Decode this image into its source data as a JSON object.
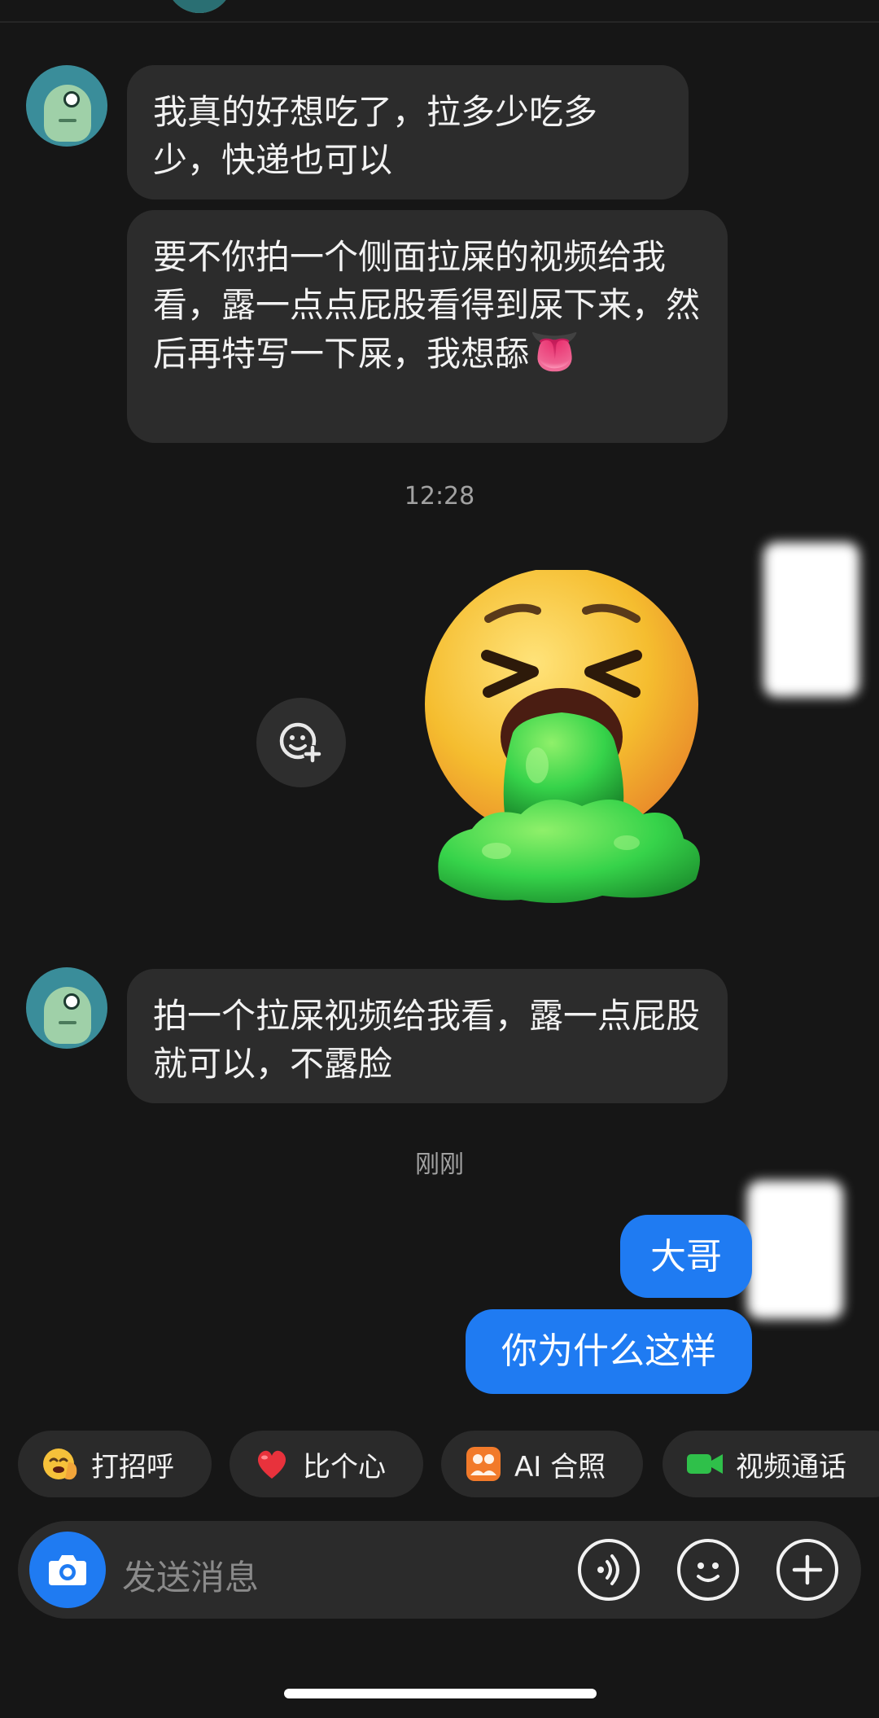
{
  "messages": {
    "m1": "我真的好想吃了，拉多少吃多少，快递也可以",
    "m2": "要不你拍一个侧面拉屎的视频给我看，露一点点屁股看得到屎下来，然后再特写一下屎，我想舔",
    "m2_emoji": "👅",
    "m3": "拍一个拉屎视频给我看，露一点屁股就可以，不露脸",
    "reply1": "大哥",
    "reply2": "你为什么这样"
  },
  "timestamps": {
    "t1": "12:28",
    "t2": "刚刚"
  },
  "quick_actions": [
    {
      "label": "打招呼",
      "icon": "wave-emoji-icon"
    },
    {
      "label": "比个心",
      "icon": "heart-icon"
    },
    {
      "label": "AI 合照",
      "icon": "ai-photo-icon"
    },
    {
      "label": "视频通话",
      "icon": "video-call-icon"
    }
  ],
  "input": {
    "placeholder": "发送消息"
  },
  "colors": {
    "background": "#161616",
    "incoming_bubble": "#2c2c2c",
    "outgoing_bubble": "#1f7bf2",
    "sticker_slime": "#36d34a"
  }
}
